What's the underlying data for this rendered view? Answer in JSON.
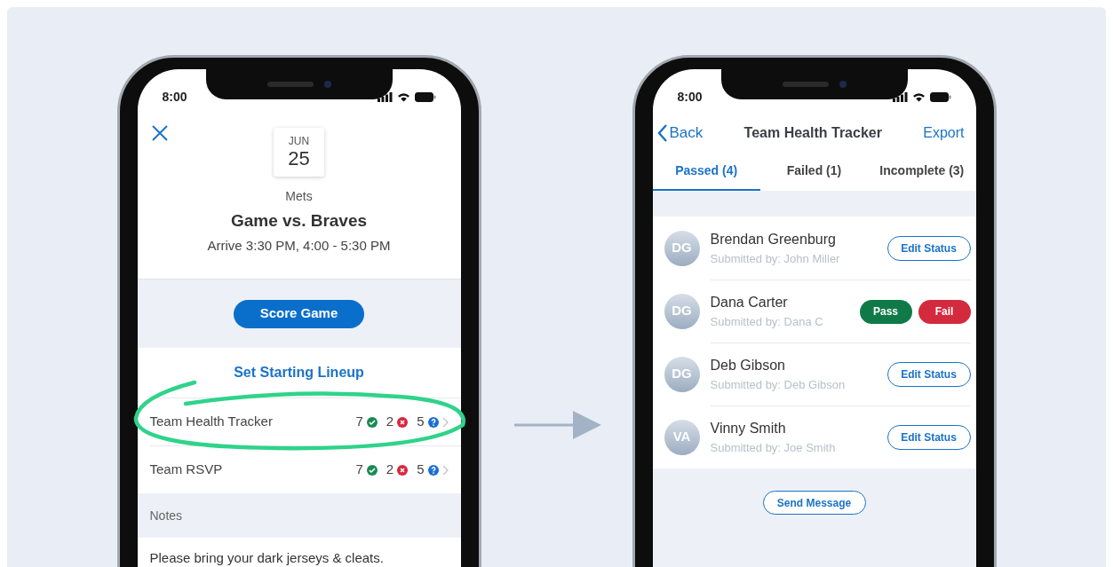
{
  "left_screen": {
    "status_bar": {
      "time": "8:00"
    },
    "event": {
      "month": "JUN",
      "day": "25",
      "team": "Mets",
      "title": "Game vs. Braves",
      "time": "Arrive 3:30 PM, 4:00 - 5:30 PM"
    },
    "score_button": "Score Game",
    "lineup_link": "Set Starting Lineup",
    "trackers": [
      {
        "label": "Team Health Tracker",
        "passed": "7",
        "failed": "2",
        "incomplete": "5"
      },
      {
        "label": "Team RSVP",
        "passed": "7",
        "failed": "2",
        "incomplete": "5"
      }
    ],
    "notes": {
      "heading": "Notes",
      "text": "Please bring your dark jerseys & cleats."
    }
  },
  "right_screen": {
    "status_bar": {
      "time": "8:00"
    },
    "nav": {
      "back": "Back",
      "title": "Team Health Tracker",
      "action": "Export"
    },
    "tabs": [
      {
        "label": "Passed (4)",
        "selected": true
      },
      {
        "label": "Failed (1)",
        "selected": false
      },
      {
        "label": "Incomplete (3)",
        "selected": false
      }
    ],
    "members": [
      {
        "initials": "DG",
        "name": "Brendan Greenburg",
        "submitted": "Submitted by: John Miller",
        "kind": "edit",
        "actions": [
          "Edit Status"
        ]
      },
      {
        "initials": "DG",
        "name": "Dana Carter",
        "submitted": "Submitted by: Dana C",
        "kind": "pass_fail",
        "actions": [
          "Pass",
          "Fail"
        ]
      },
      {
        "initials": "DG",
        "name": "Deb Gibson",
        "submitted": "Submitted by: Deb Gibson",
        "kind": "edit",
        "actions": [
          "Edit Status"
        ]
      },
      {
        "initials": "VA",
        "name": "Vinny Smith",
        "submitted": "Submitted by: Joe Smith",
        "kind": "edit",
        "actions": [
          "Edit Status"
        ]
      }
    ],
    "send_button": "Send Message"
  }
}
